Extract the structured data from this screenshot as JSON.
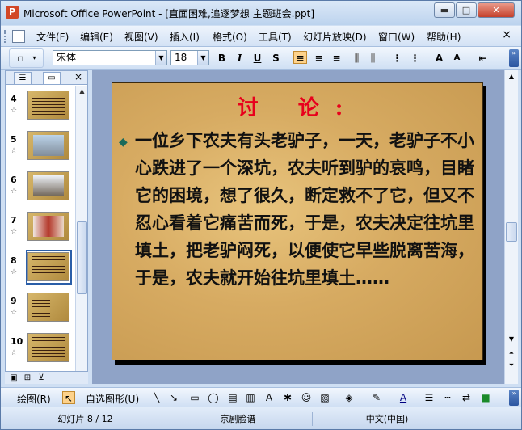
{
  "window": {
    "title": "Microsoft Office PowerPoint - [直面困难,追逐梦想 主题班会.ppt]",
    "minimize": "▬",
    "maximize": "□",
    "close": "✕"
  },
  "menu": {
    "items": [
      "文件(F)",
      "编辑(E)",
      "视图(V)",
      "插入(I)",
      "格式(O)",
      "工具(T)",
      "幻灯片放映(D)",
      "窗口(W)",
      "帮助(H)"
    ],
    "close": "×"
  },
  "toolbar": {
    "font_name": "宋体",
    "font_size": "18",
    "bold": "B",
    "italic": "I",
    "underline": "U",
    "shadow": "S"
  },
  "slides_panel": {
    "tab_outline_icon": "outline-icon",
    "tab_slides_icon": "slides-icon",
    "close": "×",
    "thumbnails": [
      {
        "number": "4",
        "style": "text"
      },
      {
        "number": "5",
        "style": "photo"
      },
      {
        "number": "6",
        "style": "photo"
      },
      {
        "number": "7",
        "style": "photo"
      },
      {
        "number": "8",
        "style": "text",
        "selected": true
      },
      {
        "number": "9",
        "style": "text-dark"
      },
      {
        "number": "10",
        "style": "text"
      }
    ],
    "star": "☆"
  },
  "slide": {
    "title": "讨 论:",
    "bullet": "◆",
    "body": "一位乡下农夫有头老驴子，一天，老驴子不小心跌进了一个深坑，农夫听到驴的哀鸣，目睹它的困境，想了很久，断定救不了它，但又不忍心看着它痛苦而死，于是，农夫决定往坑里填土，把老驴闷死，以便使它早些脱离苦海，于是，农夫就开始往坑里填土……"
  },
  "drawing_toolbar": {
    "draw_label": "绘图(R)",
    "autoshapes_label": "自选图形(U)"
  },
  "status": {
    "slide_info": "幻灯片 8 / 12",
    "design": "京剧脸谱",
    "language": "中文(中国)"
  }
}
